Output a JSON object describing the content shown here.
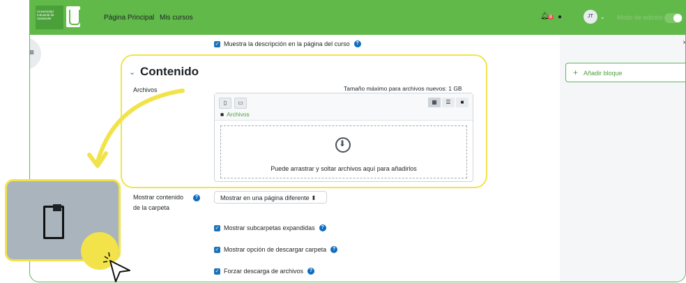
{
  "navbar": {
    "logo_text": "Universidad Industrial de Santander",
    "links": [
      "Página Principal",
      "Mis cursos"
    ],
    "notification_count": "8",
    "avatar_initials": "JT",
    "edit_mode_label": "Modo de edición"
  },
  "right_panel": {
    "add_block_label": "Añadir bloque"
  },
  "form": {
    "show_description": "Muestra la descripción en la página del curso",
    "section_title": "Contenido",
    "files_label": "Archivos",
    "max_size": "Tamaño máximo para archivos nuevos: 1 GB",
    "breadcrumb": "Archivos",
    "drop_text": "Puede arrastrar y soltar archivos aquí para añadirlos",
    "display_label_line1": "Mostrar contenido",
    "display_label_line2": "de la carpeta",
    "display_value": "Mostrar en una página diferente",
    "show_subfolders": "Mostrar subcarpetas expandidas",
    "show_download": "Mostrar opción de descargar carpeta",
    "force_download": "Forzar descarga de archivos"
  },
  "colors": {
    "navbar": "#61b94a",
    "highlight": "#f2e34a",
    "checkbox": "#1a73b8"
  }
}
